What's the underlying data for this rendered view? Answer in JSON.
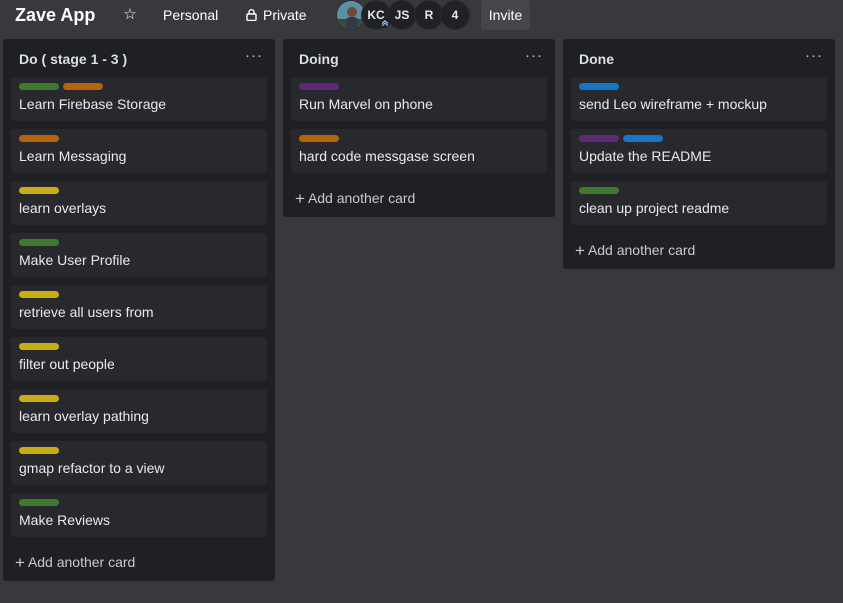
{
  "header": {
    "board_title": "Zave App",
    "star_icon": "☆",
    "personal_label": "Personal",
    "private_label": "Private",
    "members": [
      "KC",
      "JS",
      "R"
    ],
    "member_overflow": "4",
    "invite_label": "Invite"
  },
  "colors": {
    "green": "#3c7a2f",
    "orange": "#b4630f",
    "yellow": "#c9ad14",
    "purple": "#5e2a78",
    "blue": "#1677c7"
  },
  "lists": [
    {
      "title": "Do ( stage 1 - 3 )",
      "menu": "···",
      "cards": [
        {
          "labels": [
            "green",
            "orange"
          ],
          "title": "Learn Firebase Storage"
        },
        {
          "labels": [
            "orange"
          ],
          "title": "Learn Messaging"
        },
        {
          "labels": [
            "yellow"
          ],
          "title": "learn overlays"
        },
        {
          "labels": [
            "green"
          ],
          "title": "Make User Profile"
        },
        {
          "labels": [
            "yellow"
          ],
          "title": "retrieve all users from"
        },
        {
          "labels": [
            "yellow"
          ],
          "title": "filter out people"
        },
        {
          "labels": [
            "yellow"
          ],
          "title": "learn overlay pathing"
        },
        {
          "labels": [
            "yellow"
          ],
          "title": "gmap refactor to a view"
        },
        {
          "labels": [
            "green"
          ],
          "title": "Make Reviews"
        }
      ],
      "add_label": "Add another card"
    },
    {
      "title": "Doing",
      "menu": "···",
      "cards": [
        {
          "labels": [
            "purple"
          ],
          "title": "Run Marvel on phone"
        },
        {
          "labels": [
            "orange"
          ],
          "title": "hard code messgase screen"
        }
      ],
      "add_label": "Add another card"
    },
    {
      "title": "Done",
      "menu": "···",
      "cards": [
        {
          "labels": [
            "blue"
          ],
          "title": "send Leo wireframe + mockup"
        },
        {
          "labels": [
            "purple",
            "blue"
          ],
          "title": "Update the README"
        },
        {
          "labels": [
            "green"
          ],
          "title": "clean up project readme"
        }
      ],
      "add_label": "Add another card"
    }
  ]
}
